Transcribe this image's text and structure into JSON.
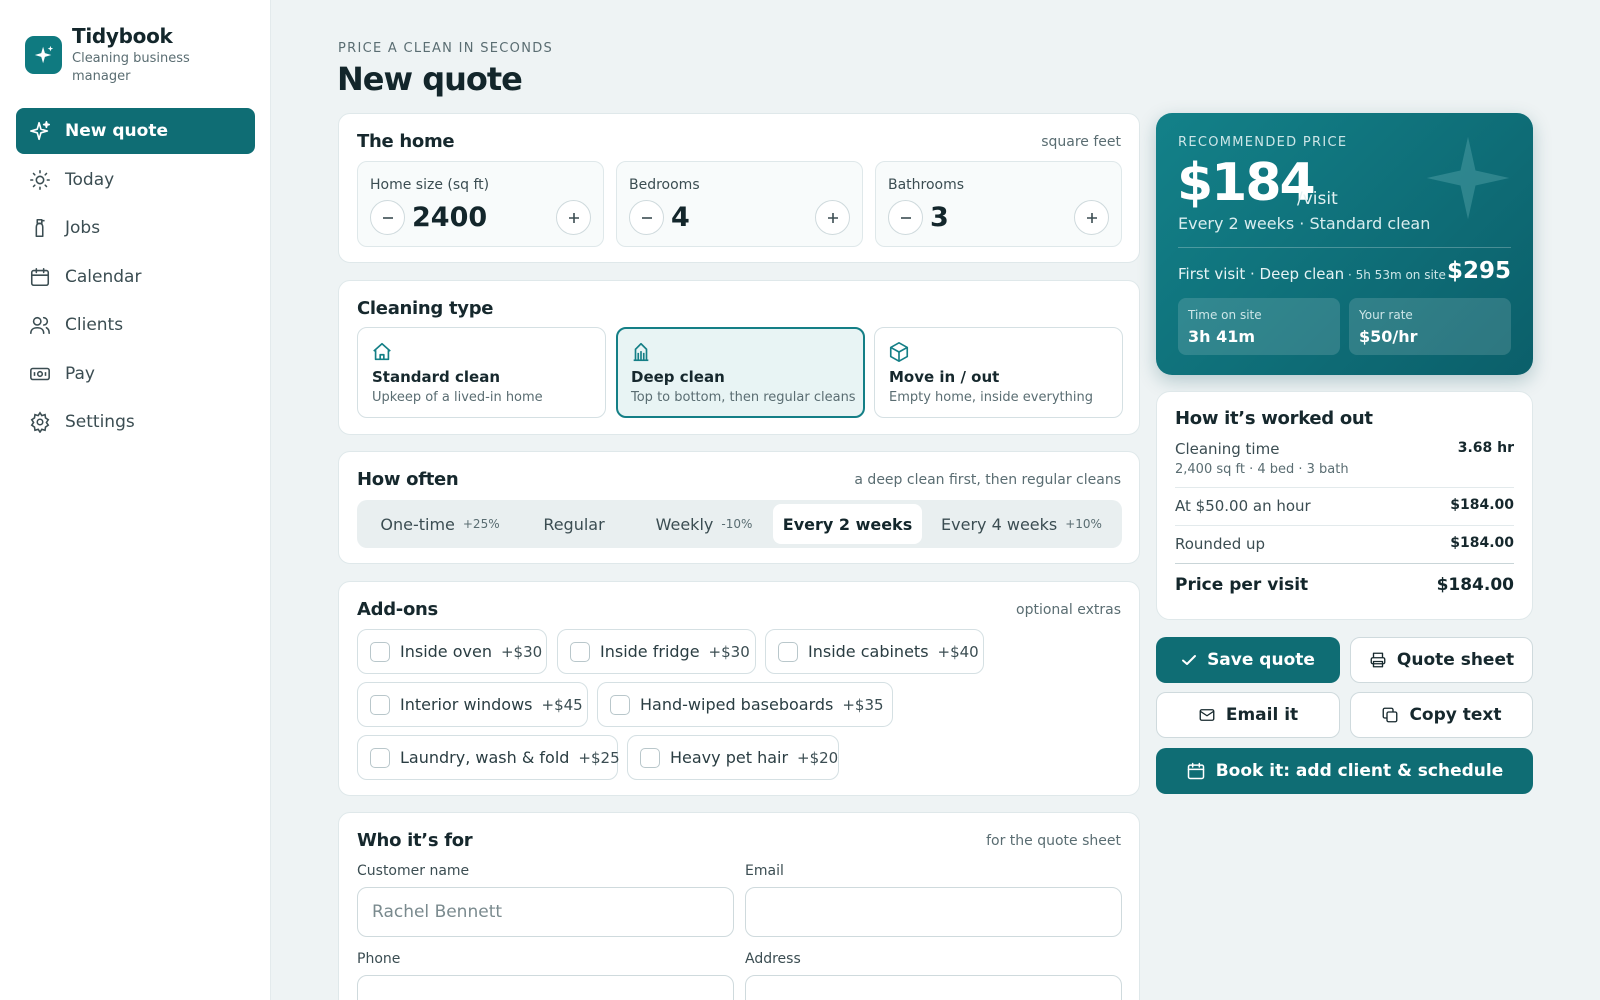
{
  "brand": {
    "name": "Tidybook",
    "subtitle": "Cleaning business manager"
  },
  "nav": [
    {
      "label": "New quote",
      "icon": "sparkle-icon",
      "active": true
    },
    {
      "label": "Today",
      "icon": "sun-icon"
    },
    {
      "label": "Jobs",
      "icon": "spray-bottle-icon"
    },
    {
      "label": "Calendar",
      "icon": "calendar-icon"
    },
    {
      "label": "Clients",
      "icon": "users-icon"
    },
    {
      "label": "Pay",
      "icon": "banknote-icon"
    },
    {
      "label": "Settings",
      "icon": "gear-icon"
    }
  ],
  "header": {
    "eyebrow": "PRICE A CLEAN IN SECONDS",
    "title": "New quote"
  },
  "home": {
    "title": "The home",
    "hint": "square feet",
    "steppers": [
      {
        "label": "Home size (sq ft)",
        "value": "2400"
      },
      {
        "label": "Bedrooms",
        "value": "4"
      },
      {
        "label": "Bathrooms",
        "value": "3"
      }
    ]
  },
  "cleaning_type": {
    "title": "Cleaning type",
    "options": [
      {
        "name": "Standard clean",
        "desc": "Upkeep of a lived-in home",
        "icon": "house-icon"
      },
      {
        "name": "Deep clean",
        "desc": "Top to bottom, then regular cleans",
        "icon": "building-icon",
        "selected": true
      },
      {
        "name": "Move in / out",
        "desc": "Empty home, inside everything",
        "icon": "box-icon"
      }
    ]
  },
  "frequency": {
    "title": "How often",
    "hint": "a deep clean first, then regular cleans",
    "options": [
      {
        "label": "One-time",
        "adj": "+25%"
      },
      {
        "label": "Regular",
        "adj": ""
      },
      {
        "label": "Weekly",
        "adj": "-10%"
      },
      {
        "label": "Every 2 weeks",
        "adj": "",
        "selected": true
      },
      {
        "label": "Every 4 weeks",
        "adj": "+10%"
      }
    ]
  },
  "addons": {
    "title": "Add-ons",
    "hint": "optional extras",
    "items": [
      {
        "name": "Inside oven",
        "price": "+$30"
      },
      {
        "name": "Inside fridge",
        "price": "+$30"
      },
      {
        "name": "Inside cabinets",
        "price": "+$40"
      },
      {
        "name": "Interior windows",
        "price": "+$45"
      },
      {
        "name": "Hand-wiped baseboards",
        "price": "+$35"
      },
      {
        "name": "Laundry, wash & fold",
        "price": "+$25"
      },
      {
        "name": "Heavy pet hair",
        "price": "+$20"
      }
    ]
  },
  "customer": {
    "title": "Who it’s for",
    "hint": "for the quote sheet",
    "name_label": "Customer name",
    "name_placeholder": "Rachel Bennett",
    "email_label": "Email",
    "email_value": "",
    "phone_label": "Phone",
    "address_label": "Address"
  },
  "price": {
    "eyebrow": "RECOMMENDED PRICE",
    "amount": "$184",
    "unit": "/visit",
    "subtitle": "Every 2 weeks · Standard clean",
    "first_visit_label": "First visit · Deep clean",
    "first_visit_time": " · 5h 53m on site",
    "first_visit_price": "$295",
    "time_label": "Time on site",
    "time_value": "3h 41m",
    "rate_label": "Your rate",
    "rate_value": "$50/hr"
  },
  "breakdown": {
    "title": "How it’s worked out",
    "cleaning_time_label": "Cleaning time",
    "cleaning_time_value": "3.68 hr",
    "cleaning_time_note": "2,400 sq ft · 4 bed · 3 bath",
    "hourly_label": "At $50.00 an hour",
    "hourly_value": "$184.00",
    "rounded_label": "Rounded up",
    "rounded_value": "$184.00",
    "total_label": "Price per visit",
    "total_value": "$184.00"
  },
  "actions": {
    "save": "Save quote",
    "sheet": "Quote sheet",
    "email": "Email it",
    "copy": "Copy text",
    "book": "Book it: add client & schedule"
  },
  "colors": {
    "accent": "#0f6d74",
    "background": "#eef3f4"
  }
}
